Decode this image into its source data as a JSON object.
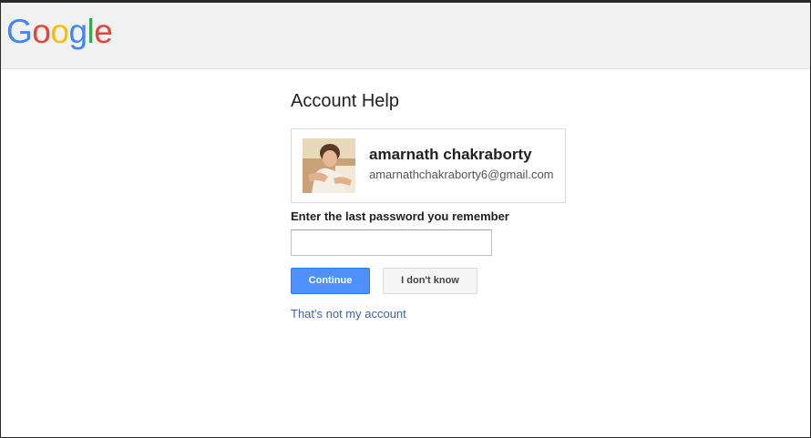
{
  "header": {
    "logo_letters": [
      "G",
      "o",
      "o",
      "g",
      "l",
      "e"
    ],
    "logo_alt": "Google"
  },
  "main": {
    "title": "Account Help",
    "account": {
      "name": "amarnath chakraborty",
      "email": "amarnathchakraborty6@gmail.com",
      "avatar": "profile-photo"
    },
    "password_label": "Enter the last password you remember",
    "password_value": "",
    "password_placeholder": "",
    "continue_label": "Continue",
    "dont_know_label": "I don't know",
    "not_my_account_label": "That's not my account"
  },
  "colors": {
    "brand_blue": "#4285f4",
    "brand_red": "#ea4335",
    "brand_yellow": "#fbbc05",
    "brand_green": "#34a853",
    "primary_button": "#4d90fe",
    "link": "#3f63a8",
    "header_bg": "#f1f1f1"
  }
}
